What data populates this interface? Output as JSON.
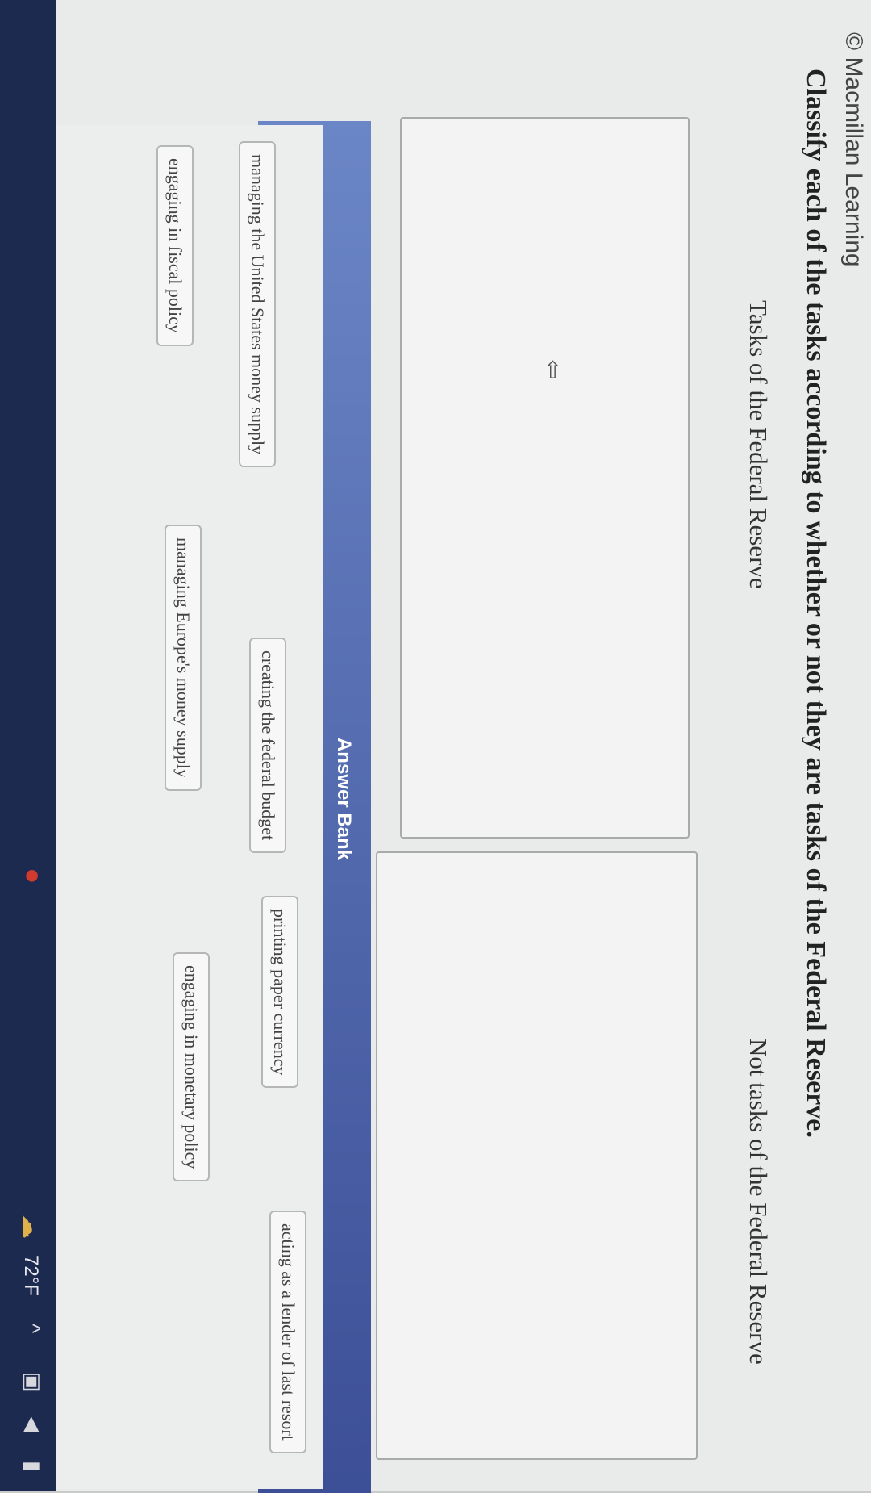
{
  "header": {
    "copyright": "© Macmillan Learning"
  },
  "question": {
    "prompt": "Classify each of the tasks according to whether or not they are tasks of the Federal Reserve."
  },
  "bins": [
    {
      "title": "Tasks of the Federal Reserve"
    },
    {
      "title": "Not tasks of the Federal Reserve"
    }
  ],
  "answer_bank": {
    "title": "Answer Bank",
    "items": [
      "managing the United States money supply",
      "creating the federal budget",
      "printing paper currency",
      "acting as a lender of last resort",
      "engaging in fiscal policy",
      "managing Europe's money supply",
      "engaging in monetary policy"
    ]
  },
  "taskbar": {
    "temperature": "72°F"
  }
}
